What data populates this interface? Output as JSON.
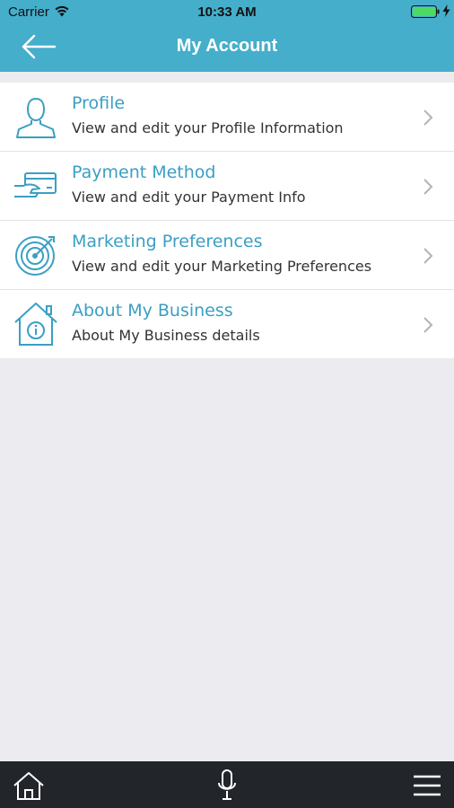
{
  "status_bar": {
    "carrier": "Carrier",
    "time": "10:33 AM"
  },
  "header": {
    "title": "My Account",
    "back_icon": "arrow-left-icon",
    "background_color": "#45aecb"
  },
  "menu_items": [
    {
      "title": "Profile",
      "description": "View and edit your Profile Information",
      "icon": "user-icon"
    },
    {
      "title": "Payment Method",
      "description": "View and edit your Payment Info",
      "icon": "credit-card-icon"
    },
    {
      "title": "Marketing Preferences",
      "description": "View and edit your Marketing Preferences",
      "icon": "target-icon"
    },
    {
      "title": "About My Business",
      "description": "About My Business details",
      "icon": "house-info-icon"
    }
  ],
  "tab_bar": {
    "items": [
      "home-icon",
      "microphone-icon",
      "hamburger-menu-icon"
    ]
  },
  "colors": {
    "accent": "#3a9fc4",
    "page_background": "#ebebf0",
    "tab_bar": "#222529",
    "battery": "#4cd964"
  }
}
